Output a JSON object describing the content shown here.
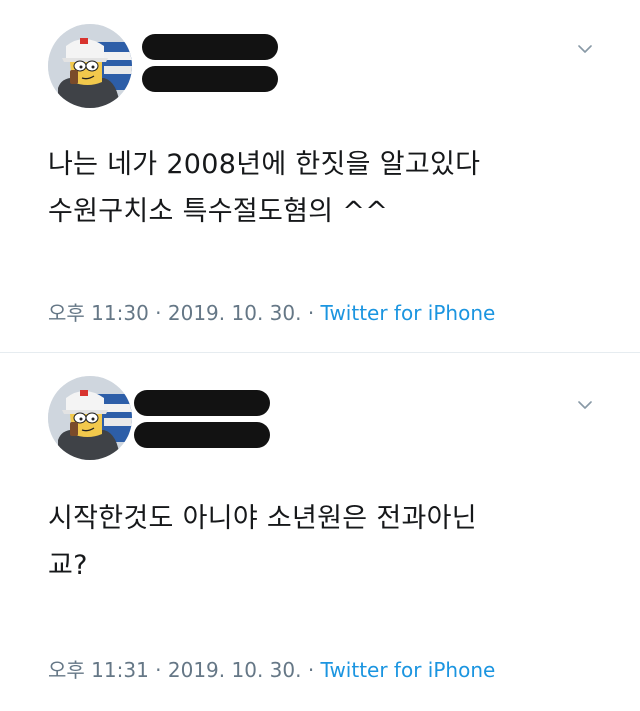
{
  "tweets": [
    {
      "author_avatar": "bart-simpson-avatar",
      "text_lines": [
        "나는 네가 2008년에 한짓을 알고있다",
        "수원구치소 특수절도혐의 ^^"
      ],
      "time": "오후 11:30",
      "date": "2019. 10. 30.",
      "source": "Twitter for iPhone",
      "separator": " · "
    },
    {
      "author_avatar": "bart-simpson-avatar",
      "text_lines": [
        "시작한것도 아니야 소년원은 전과아닌",
        "교?"
      ],
      "time": "오후 11:31",
      "date": "2019. 10. 30.",
      "source": "Twitter for iPhone",
      "separator": " · "
    }
  ],
  "icons": {
    "more_menu": "chevron-down-icon"
  },
  "colors": {
    "redaction": "#121212",
    "meta_text": "#657786",
    "source_link": "#1b95e0",
    "divider": "#e6ecf0"
  }
}
